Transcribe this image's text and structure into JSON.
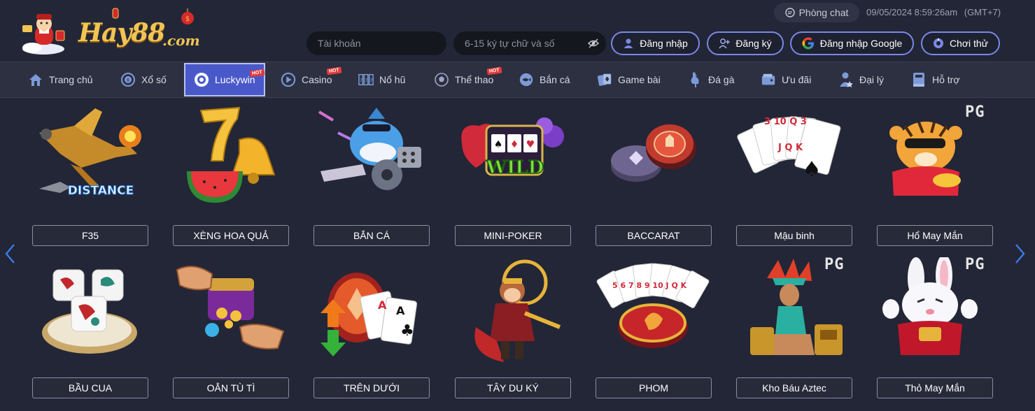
{
  "brand": {
    "name": "Hay88",
    "suffix": ".com"
  },
  "header": {
    "chat_label": "Phòng chat",
    "datetime": "09/05/2024 8:59:26am",
    "timezone": "(GMT+7)",
    "username_placeholder": "Tài khoản",
    "password_placeholder": "6-15 ký tự chữ và số",
    "login_label": "Đăng nhập",
    "register_label": "Đăng ký",
    "google_label": "Đăng nhập Google",
    "try_label": "Chơi thử"
  },
  "nav": {
    "items": [
      {
        "label": "Trang chủ",
        "icon": "home-icon"
      },
      {
        "label": "Xổ số",
        "icon": "lottery-icon"
      },
      {
        "label": "Luckywin",
        "icon": "chip-icon",
        "hot": "HOT",
        "active": true
      },
      {
        "label": "Casino",
        "icon": "play-icon",
        "hot": "HOT"
      },
      {
        "label": "Nổ hũ",
        "icon": "slot-icon"
      },
      {
        "label": "Thể thao",
        "icon": "ball-icon",
        "hot": "HOT"
      },
      {
        "label": "Bắn cá",
        "icon": "fish-icon"
      },
      {
        "label": "Game bài",
        "icon": "cards-icon"
      },
      {
        "label": "Đá gà",
        "icon": "rooster-icon"
      },
      {
        "label": "Ưu đãi",
        "icon": "wallet-icon"
      },
      {
        "label": "Đại lý",
        "icon": "agent-icon"
      },
      {
        "label": "Hỗ trợ",
        "icon": "book-icon"
      }
    ]
  },
  "games": {
    "row1": [
      {
        "label": "F35",
        "art": "jet-fighter"
      },
      {
        "label": "XÈNG HOA QUẢ",
        "art": "fruit-bell"
      },
      {
        "label": "BẮN CÁ",
        "art": "shark-gun"
      },
      {
        "label": "MINI-POKER",
        "art": "wild-slot"
      },
      {
        "label": "BACCARAT",
        "art": "chips"
      },
      {
        "label": "Mậu binh",
        "art": "card-fan"
      },
      {
        "label": "Hổ May Mắn",
        "art": "tiger",
        "badge": "PG"
      }
    ],
    "row2": [
      {
        "label": "BẦU CUA",
        "art": "dice-plate"
      },
      {
        "label": "OẲN TÙ TÌ",
        "art": "fists-chest"
      },
      {
        "label": "TRÊN DƯỚI",
        "art": "updown-cards"
      },
      {
        "label": "TÂY DU KÝ",
        "art": "monkey-king"
      },
      {
        "label": "PHOM",
        "art": "cards-chip"
      },
      {
        "label": "Kho Báu Aztec",
        "art": "aztec-queen",
        "badge": "PG"
      },
      {
        "label": "Thỏ May Mắn",
        "art": "rabbit",
        "badge": "PG"
      }
    ]
  },
  "colors": {
    "bg": "#232636",
    "nav_bg": "#2c3040",
    "accent": "#4a59c9",
    "button_border": "#7a88e8",
    "gold": "#f1c453"
  }
}
